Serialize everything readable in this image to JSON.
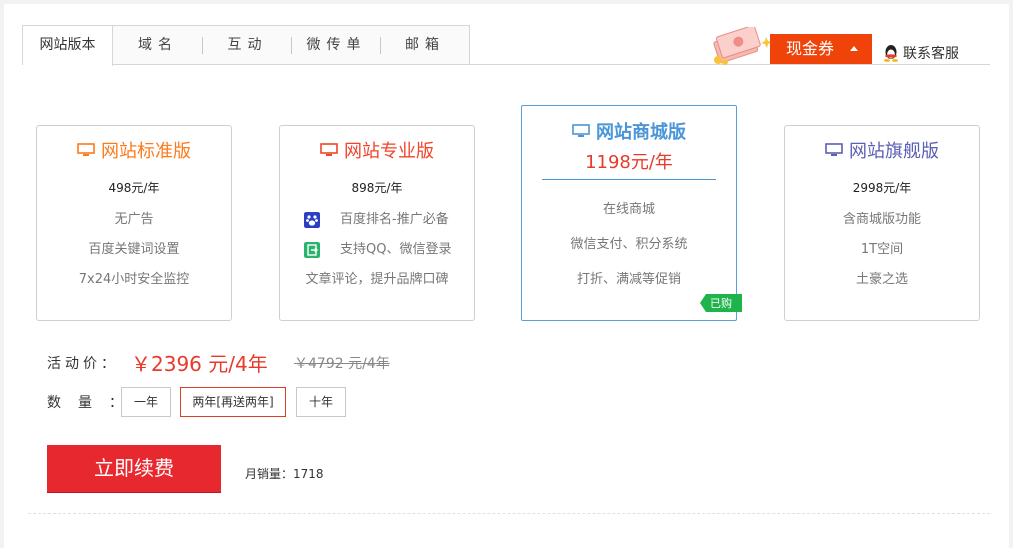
{
  "tabs": [
    "网站版本",
    "域名",
    "互动",
    "微传单",
    "邮箱"
  ],
  "coupon": {
    "label": "现金券"
  },
  "contact": {
    "label": "联系客服"
  },
  "cards": [
    {
      "title": "网站标准版",
      "price": "498元/年",
      "features": [
        "无广告",
        "百度关键词设置",
        "7x24小时安全监控"
      ]
    },
    {
      "title": "网站专业版",
      "price": "898元/年",
      "features": [
        "百度排名-推广必备",
        "支持QQ、微信登录",
        "文章评论，提升品牌口碑"
      ]
    },
    {
      "title": "网站商城版",
      "price": "1198元/年",
      "features": [
        "在线商城",
        "微信支付、积分系统",
        "打折、满减等促销"
      ],
      "badge": "已购"
    },
    {
      "title": "网站旗舰版",
      "price": "2998元/年",
      "features": [
        "含商城版功能",
        "1T空间",
        "土豪之选"
      ]
    }
  ],
  "order": {
    "price_label": "活动价：",
    "price": "￥2396 元/4年",
    "old_price": "￥4792 元/4年",
    "qty_label": "数量：",
    "quantities": [
      "一年",
      "两年[再送两年]",
      "十年"
    ],
    "selected_quantity": "两年[再送两年]",
    "buy_label": "立即续费",
    "monthly_sales": "月销量：1718"
  },
  "colors": {
    "accent_red": "#e8282f",
    "coupon_orange": "#f0430a",
    "selected_blue": "#4b96d6",
    "badge_green": "#1fb34b"
  }
}
